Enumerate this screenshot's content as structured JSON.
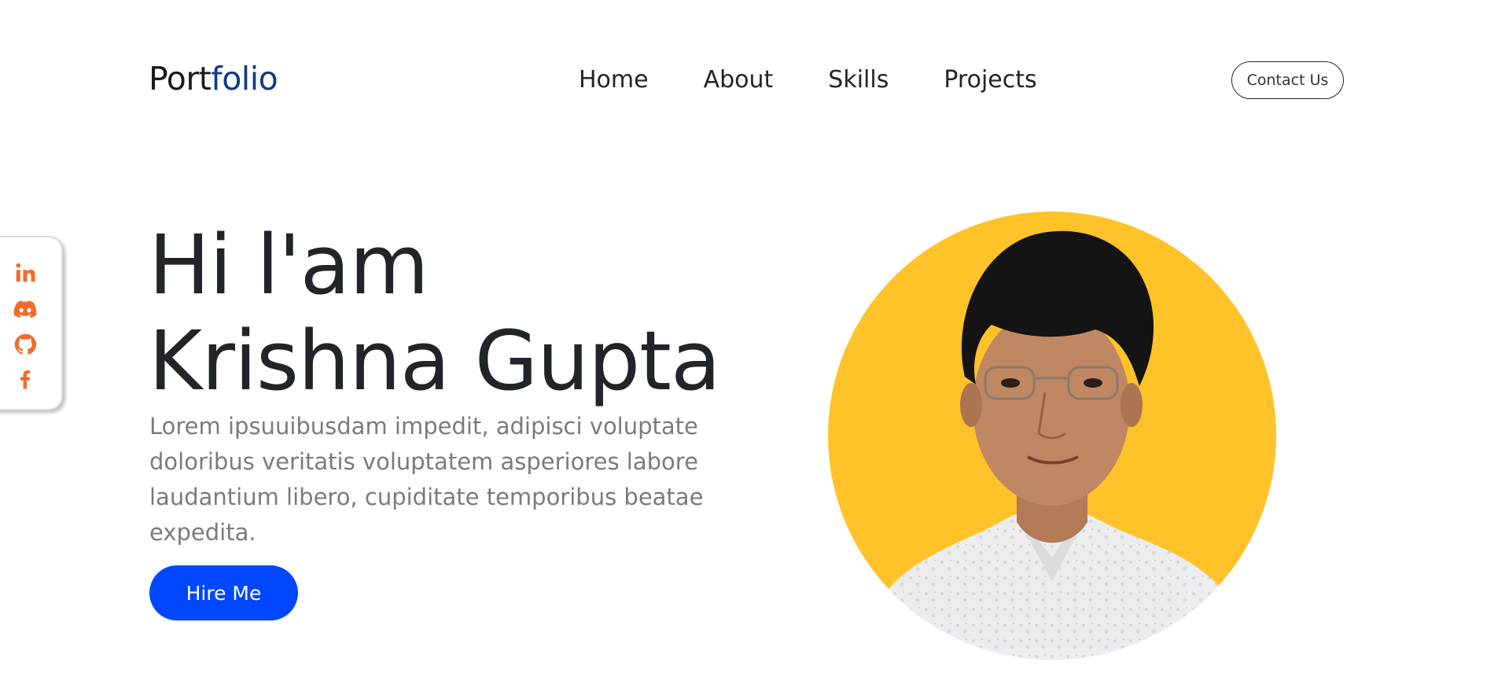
{
  "logo": {
    "part1": "Port",
    "part2": "folio",
    "accent_color": "#0d3b8c"
  },
  "nav": {
    "items": [
      "Home",
      "About",
      "Skills",
      "Projects"
    ]
  },
  "header": {
    "contact_label": "Contact Us"
  },
  "social": {
    "icons": [
      "linkedin-icon",
      "discord-icon",
      "github-icon",
      "facebook-icon"
    ],
    "icon_color": "#f26b2a"
  },
  "hero": {
    "greeting": "Hi l'am",
    "name": "Krishna Gupta",
    "description": "Lorem ipsuuibusdam impedit, adipisci voluptate doloribus veritatis voluptatem asperiores labore laudantium libero, cupiditate temporibus beatae expedita.",
    "cta_label": "Hire Me",
    "cta_color": "#0047ff"
  },
  "portrait": {
    "background_color": "#ffc228",
    "subject": "profile-photo"
  }
}
